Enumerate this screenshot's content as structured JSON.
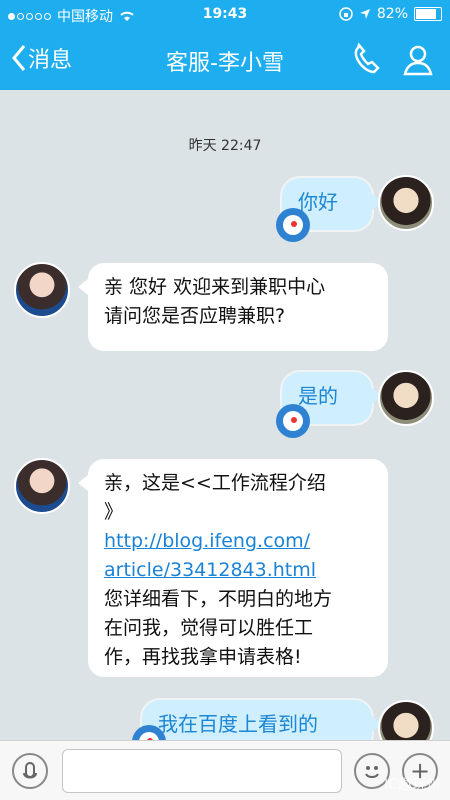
{
  "status": {
    "carrier": "中国移动",
    "time": "19:43",
    "battery_pct": "82%",
    "battery_level": 0.82
  },
  "nav": {
    "back_label": "消息",
    "title": "客服-李小雪"
  },
  "chat": {
    "timestamp": "昨天 22:47",
    "messages": [
      {
        "side": "right",
        "text": "你好"
      },
      {
        "side": "left",
        "line1": "亲 您好 欢迎来到兼职中心",
        "line2": "请问您是否应聘兼职?"
      },
      {
        "side": "right",
        "text": "是的"
      },
      {
        "side": "left",
        "line1": "亲，这是<<工作流程介绍",
        "line2": "》",
        "link1": "http://blog.ifeng.com/",
        "link2": "article/33412843.html",
        "line3": "您详细看下，不明白的地方",
        "line4": "在问我，觉得可以胜任工",
        "line5": "作，再找我拿申请表格!"
      },
      {
        "side": "right",
        "text": "我在百度上看到的"
      }
    ]
  },
  "input": {
    "placeholder": ""
  },
  "watermark": "IC趣玩州"
}
